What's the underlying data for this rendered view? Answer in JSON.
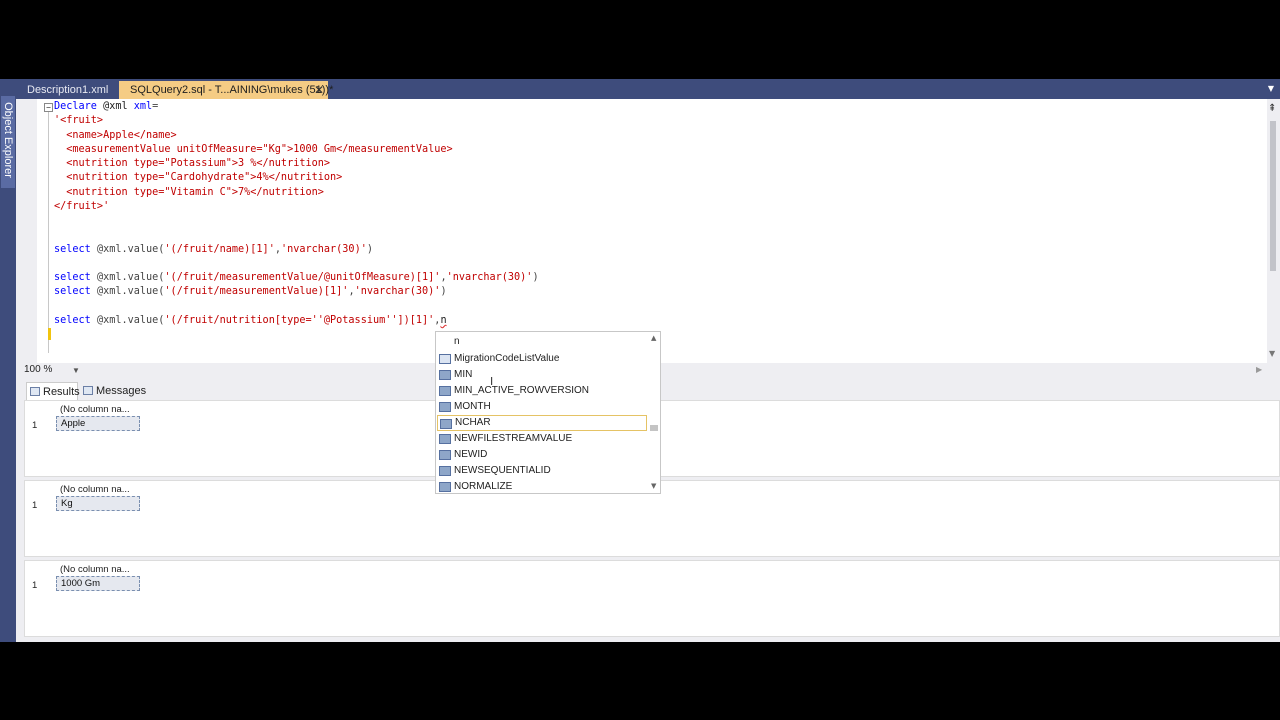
{
  "object_explorer": {
    "label": "Object Explorer"
  },
  "tabs": [
    {
      "label": "Description1.xml"
    },
    {
      "label": "SQLQuery2.sql - T...AINING\\mukes (51))*",
      "close": "✕"
    }
  ],
  "editor": {
    "collapse_glyph": "−",
    "lines": {
      "l1": {
        "a": "Declare",
        "b": " @xml ",
        "c": "xml",
        "d": "="
      },
      "l2": "'<fruit>",
      "l3": "  <name>Apple</name>",
      "l4": "  <measurementValue unitOfMeasure=\"Kg\">1000 Gm</measurementValue>",
      "l5": "  <nutrition type=\"Potassium\">3 %</nutrition>",
      "l6": "  <nutrition type=\"Cardohydrate\">4%</nutrition>",
      "l7": "  <nutrition type=\"Vitamin C\">7%</nutrition>",
      "l8": "</fruit>'",
      "q1": {
        "kw": "select",
        "mid": " @xml.value(",
        "s": "'(/fruit/name)[1]'",
        "c": ",",
        "s2": "'nvarchar(30)'",
        "e": ")"
      },
      "q2": {
        "kw": "select",
        "mid": " @xml.value(",
        "s": "'(/fruit/measurementValue/@unitOfMeasure)[1]'",
        "c": ",",
        "s2": "'nvarchar(30)'",
        "e": ")"
      },
      "q3": {
        "kw": "select",
        "mid": " @xml.value(",
        "s": "'(/fruit/measurementValue)[1]'",
        "c": ",",
        "s2": "'nvarchar(30)'",
        "e": ")"
      },
      "q4": {
        "kw": "select",
        "mid": " @xml.value(",
        "s": "'(/fruit/nutrition[type=''@Potassium''])[1]'",
        "c": ",",
        "typed": "n"
      }
    }
  },
  "zoom": {
    "value": "100 %"
  },
  "result_tabs": {
    "results": "Results",
    "messages": "Messages"
  },
  "grids": [
    {
      "header": "(No column na...",
      "row": "1",
      "value": "Apple"
    },
    {
      "header": "(No column na...",
      "row": "1",
      "value": "Kg"
    },
    {
      "header": "(No column na...",
      "row": "1",
      "value": "1000 Gm"
    }
  ],
  "intellisense": {
    "typed": "n",
    "items": [
      {
        "label": "MigrationCodeListValue",
        "icon": "type-icon"
      },
      {
        "label": "MIN",
        "icon": "function-icon"
      },
      {
        "label": "MIN_ACTIVE_ROWVERSION",
        "icon": "function-icon"
      },
      {
        "label": "MONTH",
        "icon": "function-icon"
      },
      {
        "label": "NCHAR",
        "icon": "function-icon",
        "selected": true
      },
      {
        "label": "NEWFILESTREAMVALUE",
        "icon": "function-icon"
      },
      {
        "label": "NEWID",
        "icon": "function-icon"
      },
      {
        "label": "NEWSEQUENTIALID",
        "icon": "function-icon"
      },
      {
        "label": "NORMALIZE",
        "icon": "function-icon"
      }
    ]
  },
  "colors": {
    "chrome": "#3e4c7c",
    "active_tab": "#f5cc84",
    "keyword": "#0000ff",
    "string": "#c00000"
  }
}
